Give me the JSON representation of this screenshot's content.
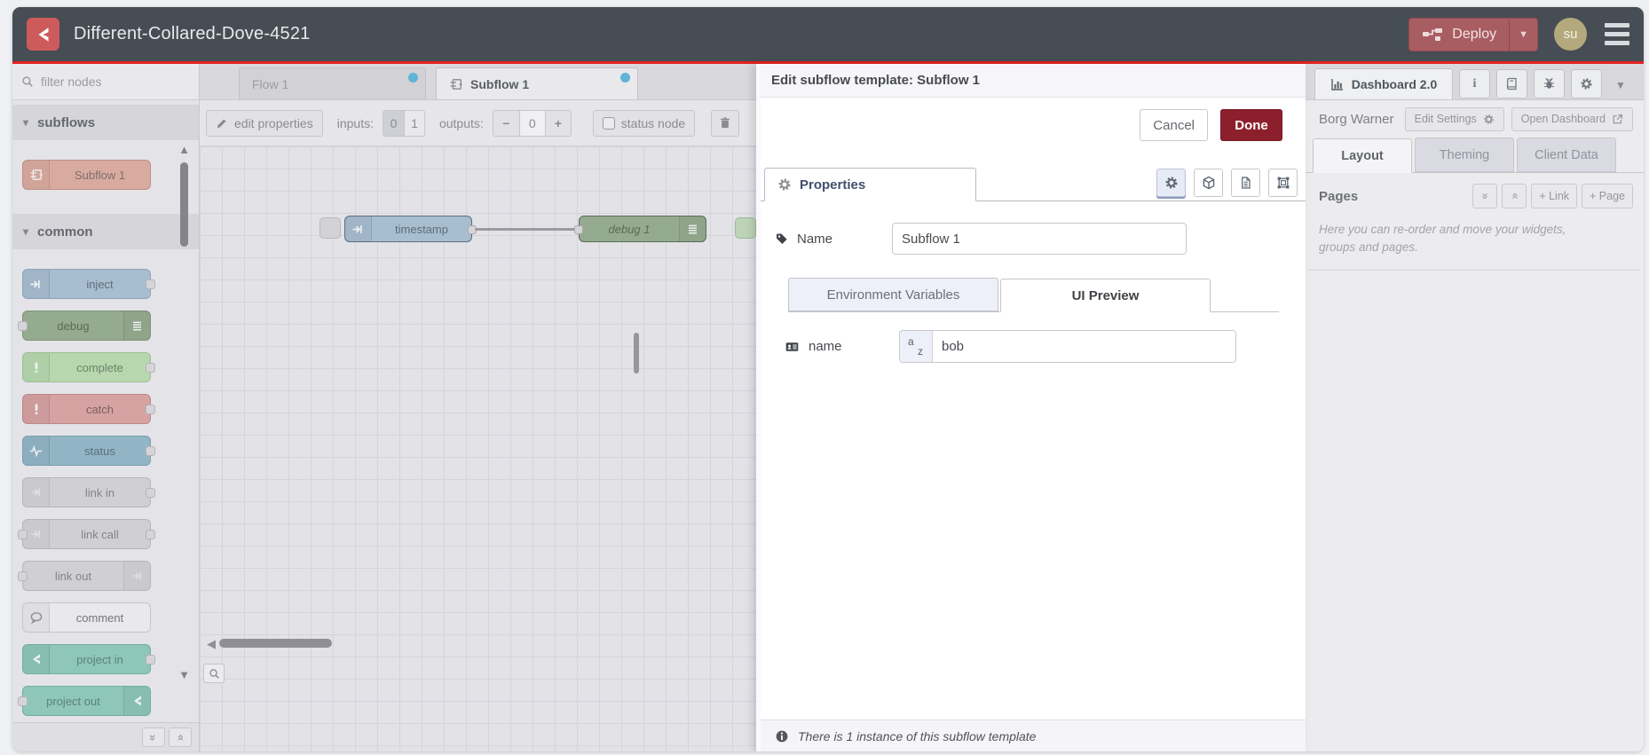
{
  "header": {
    "title": "Different-Collared-Dove-4521",
    "deploy_label": "Deploy",
    "avatar_initials": "su"
  },
  "palette": {
    "filter_placeholder": "filter nodes",
    "categories": [
      {
        "label": "subflows",
        "nodes": [
          {
            "label": "Subflow 1",
            "icon": "subflow-icon"
          }
        ]
      },
      {
        "label": "common",
        "nodes": [
          {
            "label": "inject",
            "icon": "arrow-in-icon"
          },
          {
            "label": "debug",
            "icon": "debug-lines-icon"
          },
          {
            "label": "complete",
            "icon": "exclamation-icon"
          },
          {
            "label": "catch",
            "icon": "exclamation-icon"
          },
          {
            "label": "status",
            "icon": "pulse-icon"
          },
          {
            "label": "link in",
            "icon": "link-arrow-icon"
          },
          {
            "label": "link call",
            "icon": "link-arrow-icon"
          },
          {
            "label": "link out",
            "icon": "link-arrow-icon"
          },
          {
            "label": "comment",
            "icon": "speech-bubble-icon"
          },
          {
            "label": "project in",
            "icon": "project-icon"
          },
          {
            "label": "project out",
            "icon": "project-icon"
          }
        ]
      }
    ]
  },
  "workspace": {
    "tabs": [
      {
        "label": "Flow 1",
        "active": false
      },
      {
        "label": "Subflow 1",
        "active": true
      }
    ],
    "toolbar": {
      "edit_properties": "edit properties",
      "inputs_label": "inputs:",
      "inputs_options": [
        "0",
        "1"
      ],
      "inputs_selected": "0",
      "outputs_label": "outputs:",
      "outputs_minus": "−",
      "outputs_value": "0",
      "outputs_plus": "+",
      "status_node": "status node"
    },
    "flow_nodes": [
      {
        "label": "timestamp",
        "icon": "arrow-in-icon"
      },
      {
        "label": "debug 1",
        "icon": "debug-lines-icon"
      }
    ]
  },
  "tray": {
    "title": "Edit subflow template: Subflow 1",
    "cancel_label": "Cancel",
    "done_label": "Done",
    "properties_tab": "Properties",
    "name_label": "Name",
    "name_value": "Subflow 1",
    "env_tab": "Environment Variables",
    "ui_tab": "UI Preview",
    "field": {
      "label": "name",
      "type_top": "a",
      "type_bottom": "z",
      "value": "bob"
    },
    "footer_text": "There is 1 instance of this subflow template"
  },
  "sidebar": {
    "dashboard_tab": "Dashboard 2.0",
    "instance_name": "Borg Warner",
    "edit_settings_label": "Edit Settings",
    "open_dashboard_label": "Open Dashboard",
    "tabs": [
      "Layout",
      "Theming",
      "Client Data"
    ],
    "pages_title": "Pages",
    "link_button": "+ Link",
    "page_button": "+ Page",
    "help_text": "Here you can re-order and move your widgets, groups and pages."
  },
  "colors": {
    "header_bg": "#464d54",
    "accent_red_line": "#e0211f",
    "deploy_bg": "#a85d62",
    "done_bg": "#8c1f2c",
    "tab_dot_blue": "#5fb3d6",
    "node_subflow": "#d9aba0",
    "node_inject": "#a7bdd0",
    "node_debug": "#95ab8f",
    "node_complete": "#b7d8af",
    "node_catch": "#d6a2a2",
    "node_status": "#92b5c5",
    "node_link": "#d0d0d4",
    "node_comment": "#e9e9ec",
    "node_project": "#8ec6ba"
  }
}
